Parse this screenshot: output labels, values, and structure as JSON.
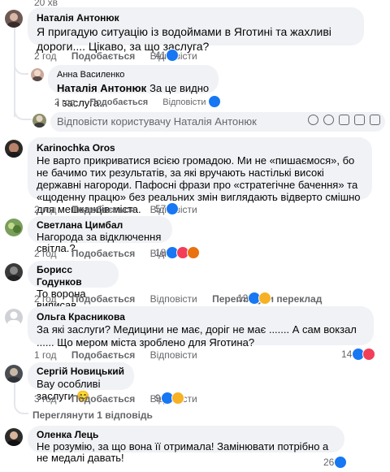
{
  "top_time": "20 хв",
  "reply_placeholder": "Відповісти користувачу Наталія Антонюк",
  "labels": {
    "like": "Подобається",
    "reply": "Відповісти",
    "translate": "Переглянути переклад"
  },
  "view_more_replies": "Переглянути 1 відповідь",
  "comments": [
    {
      "author": "Наталія Антонюк",
      "text": "Я пригадую ситуацію із водоймами в Яготині та жахливі дороги.... Цікаво, за що заслуга?",
      "time": "2 год",
      "reactions": {
        "count": "41",
        "icons": [
          "like"
        ]
      },
      "replies": [
        {
          "author": "Анна Василенко",
          "mention": "Наталія Антонюк",
          "text": "За це видно і заслуга...",
          "time": "2 год",
          "reactions": {
            "count": "",
            "icons": [
              "like"
            ]
          }
        }
      ]
    },
    {
      "author": "Karinochka Oros",
      "text": "Не варто прикриватися всією громадою. Ми не «пишаємося», бо не бачимо тих результатів, за які вручають настількі високі державні нагороди. Пафосні фрази про «стратегічне бачення» та «щоденну працю» без реальних змін виглядають відверто смішно для мешканців міста.",
      "time": "2 год",
      "reactions": {
        "count": "57",
        "icons": [
          "like"
        ]
      }
    },
    {
      "author": "Светлана Цимбал",
      "text": "Нагорода за відключення світла.?",
      "time": "2 год",
      "reactions": {
        "count": "18",
        "icons": [
          "like",
          "love",
          "angry"
        ]
      }
    },
    {
      "author": "Борисс Годунков",
      "text": "То ворона виписав..",
      "time": "2 год",
      "translate": true,
      "reactions": {
        "count": "12",
        "icons": [
          "like",
          "haha"
        ]
      }
    },
    {
      "author": "Ольга Красникова",
      "text": "За які заслуги? Медицини не має, доріг не має ....... А сам вокзал ...... Що мером міста зроблено для Яготина?",
      "time": "1 год",
      "reactions": {
        "count": "14",
        "icons": [
          "like",
          "love"
        ]
      }
    },
    {
      "author": "Сергій Новицький",
      "text": "Вау особливі заслуги 😊",
      "time": "3 год",
      "reactions": {
        "count": "9",
        "icons": [
          "like",
          "haha"
        ]
      }
    },
    {
      "author": "Оленка Лець",
      "text": "Не розумію, за що вона її отримала! Замінювати потрібно а не медалі давать!",
      "time": "2 год",
      "reactions": {
        "count": "26",
        "icons": [
          "like"
        ]
      }
    }
  ],
  "colors": {
    "bubble": "#f0f2f5",
    "secondary_text": "#65676b",
    "like": "#1877f2",
    "love": "#f33e58",
    "haha": "#f7b125",
    "angry": "#e9710f"
  }
}
